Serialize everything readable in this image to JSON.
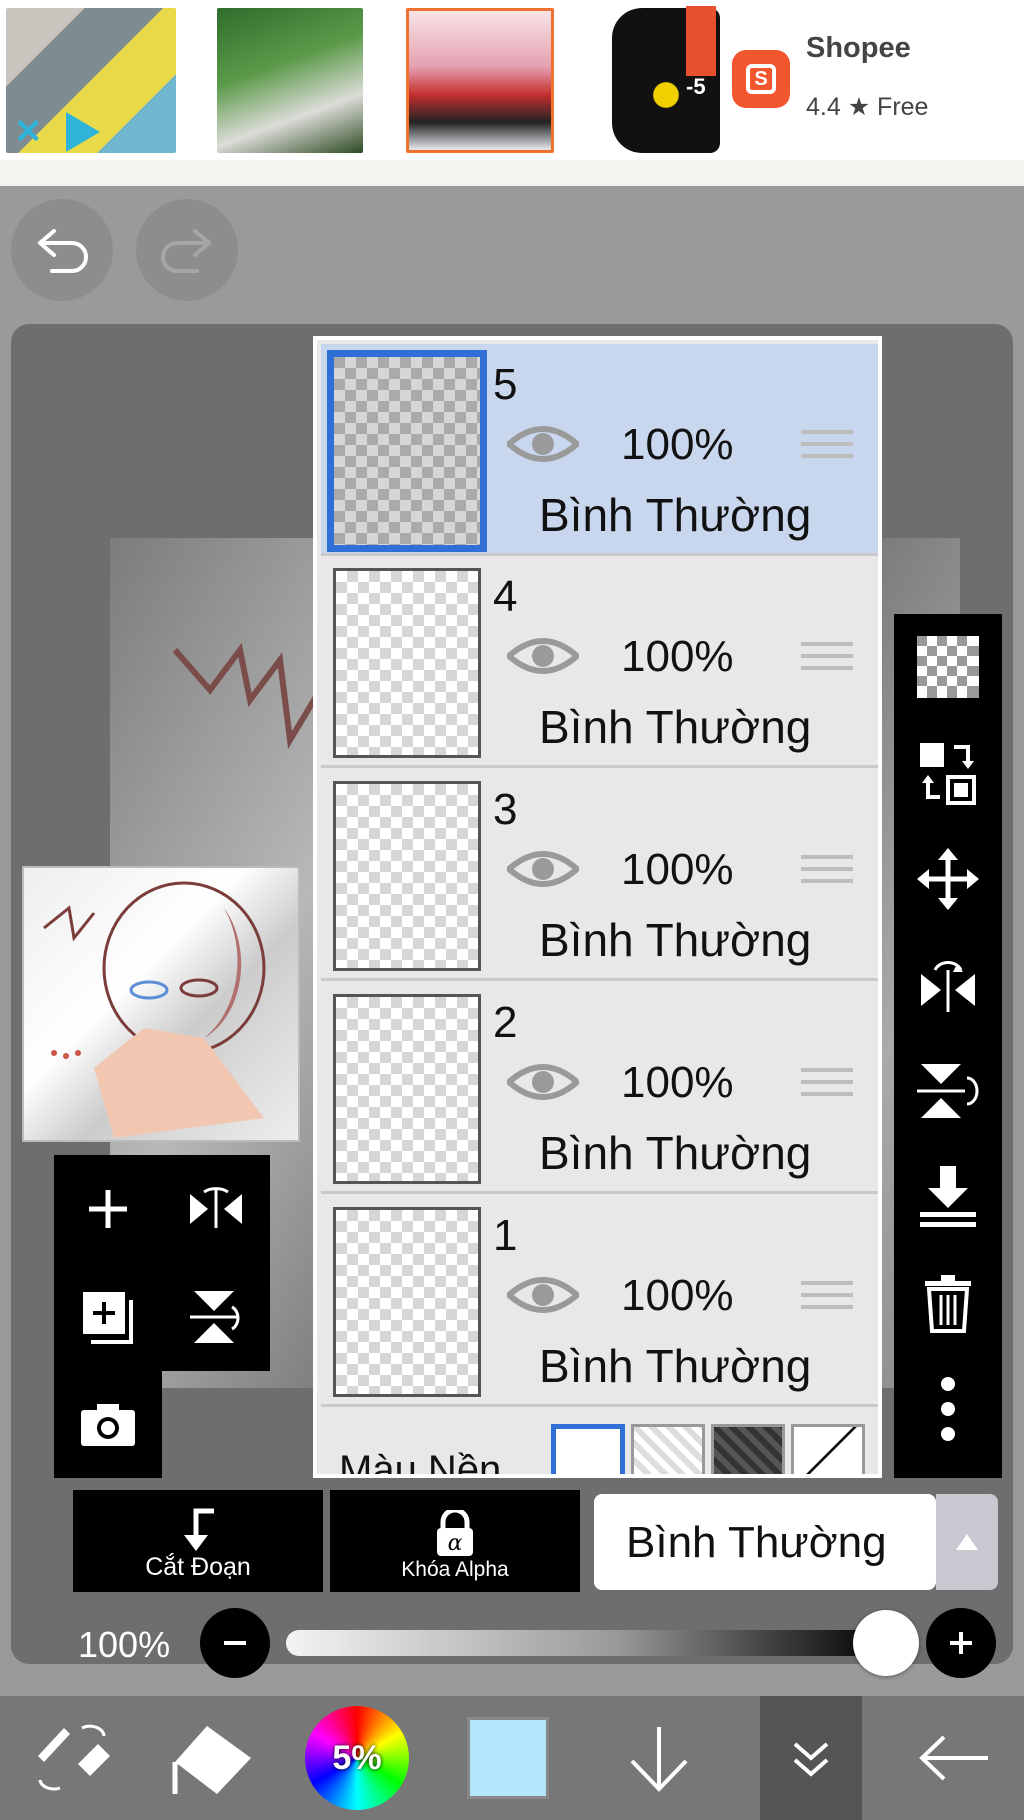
{
  "ad": {
    "app_name": "Shopee",
    "rating": "4.4 ★ Free",
    "logo_letter": "S",
    "discount_fragment": "-5"
  },
  "layers": [
    {
      "number": "5",
      "opacity": "100%",
      "mode": "Bình Thường",
      "selected": true
    },
    {
      "number": "4",
      "opacity": "100%",
      "mode": "Bình Thường",
      "selected": false
    },
    {
      "number": "3",
      "opacity": "100%",
      "mode": "Bình Thường",
      "selected": false
    },
    {
      "number": "2",
      "opacity": "100%",
      "mode": "Bình Thường",
      "selected": false
    },
    {
      "number": "1",
      "opacity": "100%",
      "mode": "Bình Thường",
      "selected": false
    }
  ],
  "background_row": {
    "label": "Màu Nền"
  },
  "controls": {
    "clip_label": "Cắt Đoạn",
    "alpha_lock_label": "Khóa Alpha",
    "blend_mode": "Bình Thường",
    "opacity_value": "100%",
    "opacity_level": 1.0
  },
  "bottom_nav": {
    "brush_size": "5%",
    "current_color": "#b3e5fb"
  },
  "colors": {
    "selected_layer": "#c8d7ee",
    "selection_border": "#2f6fd6",
    "shopee_orange": "#f1562e"
  }
}
